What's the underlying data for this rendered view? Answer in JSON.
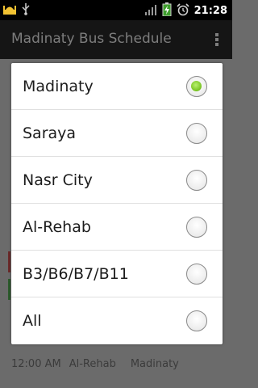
{
  "status_bar": {
    "time": "21:28",
    "icons": [
      "mosque-icon",
      "usb-icon",
      "signal-icon",
      "battery-charging-icon",
      "alarm-icon"
    ]
  },
  "action_bar": {
    "title": "Madinaty Bus Schedule"
  },
  "background": {
    "partial_text": "...",
    "row": {
      "time": "12:00 AM",
      "from": "Al-Rehab",
      "to": "Madinaty"
    }
  },
  "dialog": {
    "selected_index": 0,
    "options": [
      {
        "label": "Madinaty"
      },
      {
        "label": "Saraya"
      },
      {
        "label": "Nasr City"
      },
      {
        "label": "Al-Rehab"
      },
      {
        "label": "B3/B6/B7/B11"
      },
      {
        "label": "All"
      }
    ]
  },
  "colors": {
    "accent_green": "#76c21f",
    "status_bar_bg": "#000000",
    "dim_background": "#6b6b6b"
  }
}
